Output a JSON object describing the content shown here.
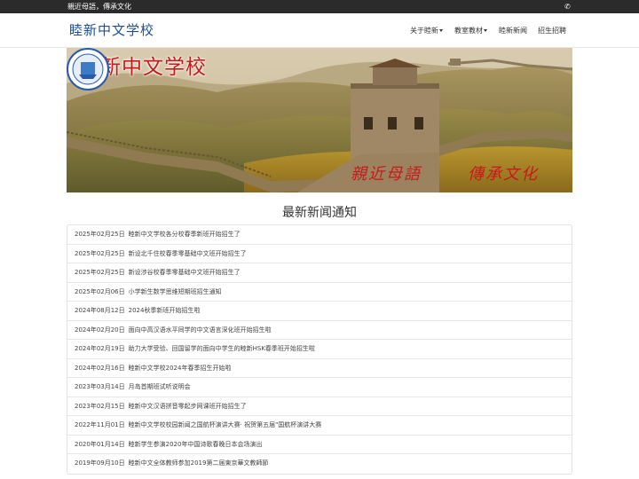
{
  "topbar": {
    "slogan": "親近母語，傳承文化",
    "phone_icon": "phone-icon"
  },
  "header": {
    "brand": "睦新中文学校",
    "nav": [
      {
        "label": "关于睦新",
        "dropdown": true
      },
      {
        "label": "教室教材",
        "dropdown": true
      },
      {
        "label": "睦新新闻",
        "dropdown": false
      },
      {
        "label": "招生招聘",
        "dropdown": false
      }
    ]
  },
  "banner": {
    "title": "睦新中文学校",
    "motto_left": "親近母語",
    "motto_right": "傳承文化"
  },
  "news": {
    "title": "最新新闻通知",
    "items": [
      {
        "date": "2025年02月25日",
        "title": "睦新中文学校各分校春季新班开始招生了"
      },
      {
        "date": "2025年02月25日",
        "title": "新设北千住校春季零基础中文班开始招生了"
      },
      {
        "date": "2025年02月25日",
        "title": "新设涉谷校春季零基础中文班开始招生了"
      },
      {
        "date": "2025年02月06日",
        "title": "小学新生数学思维短期班招生通知"
      },
      {
        "date": "2024年08月12日",
        "title": "2024秋季新班开始招生啦"
      },
      {
        "date": "2024年02月20日",
        "title": "面向中高汉语水平同学的中文语言深化班开始招生啦"
      },
      {
        "date": "2024年02月19日",
        "title": "助力大学受验、回国留学的面向中学生的睦新HSK春季班开始招生啦"
      },
      {
        "date": "2024年02月16日",
        "title": "睦新中文学校2024年春季招生开始啦"
      },
      {
        "date": "2023年03月14日",
        "title": "月岛首期班试听说明会"
      },
      {
        "date": "2023年02月15日",
        "title": "睦新中文汉语拼音零起步网课班开始招生了"
      },
      {
        "date": "2022年11月01日",
        "title": "睦新中文学校校园新闻之国航杯演讲大赛· 祝贺第五届\"国航杯演讲大赛"
      },
      {
        "date": "2020年01月14日",
        "title": "睦新学生参演2020年中国诗歌春晚日本会场演出"
      },
      {
        "date": "2019年09月10日",
        "title": "睦新中文全体教师参加2019第二届東京華文教師節"
      }
    ]
  }
}
